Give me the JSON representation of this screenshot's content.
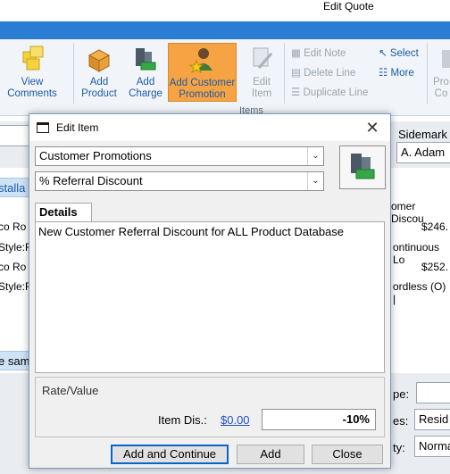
{
  "window": {
    "title": "Edit Quote"
  },
  "ribbon": {
    "view_comments": "View Comments",
    "add_product": "Add Product",
    "add_charge": "Add Charge",
    "add_customer_promotion": "Add Customer Promotion",
    "edit_item": "Edit Item",
    "items_group": "Items",
    "edit_note": "Edit Note",
    "delete_line": "Delete Line",
    "duplicate_line": "Duplicate Line",
    "select": "Select",
    "more": "More",
    "right_partial": "Pro Co",
    "left_partial": "t"
  },
  "background": {
    "sidemark_label": "Sidemark",
    "sidemark_value": "A. Adam",
    "installation_partial": "stalla",
    "discount_header_partial": "omer Discou",
    "rows": [
      {
        "left": "co Ro",
        "price": "$246.",
        "style": "Style:F",
        "desc": "ontinuous Lo"
      },
      {
        "left": "co Ro",
        "price": "$252.",
        "style": "Style:F",
        "desc": "ordless (O) |"
      }
    ],
    "same_partial": "e sam",
    "type_label_partial": "pe:",
    "res_label_partial": "es:",
    "res_value_partial": "Resid",
    "qty_label_partial": "ty:",
    "qty_value_partial": "Norma"
  },
  "dialog": {
    "title": "Edit Item",
    "category_selected": "Customer Promotions",
    "promotion_selected": "% Referral Discount",
    "details_tab": "Details",
    "details_text": "New Customer Referral Discount for ALL Product Database",
    "rate_label": "Rate/Value",
    "item_dis_label": "Item Dis.:",
    "item_dis_value": "$0.00",
    "rate_value": "-10%",
    "buttons": {
      "add_continue": "Add and Continue",
      "add": "Add",
      "close": "Close"
    }
  },
  "colors": {
    "accent": "#2b7cd3",
    "ribbon_highlight": "#f6a343",
    "link": "#1f4fc1"
  }
}
